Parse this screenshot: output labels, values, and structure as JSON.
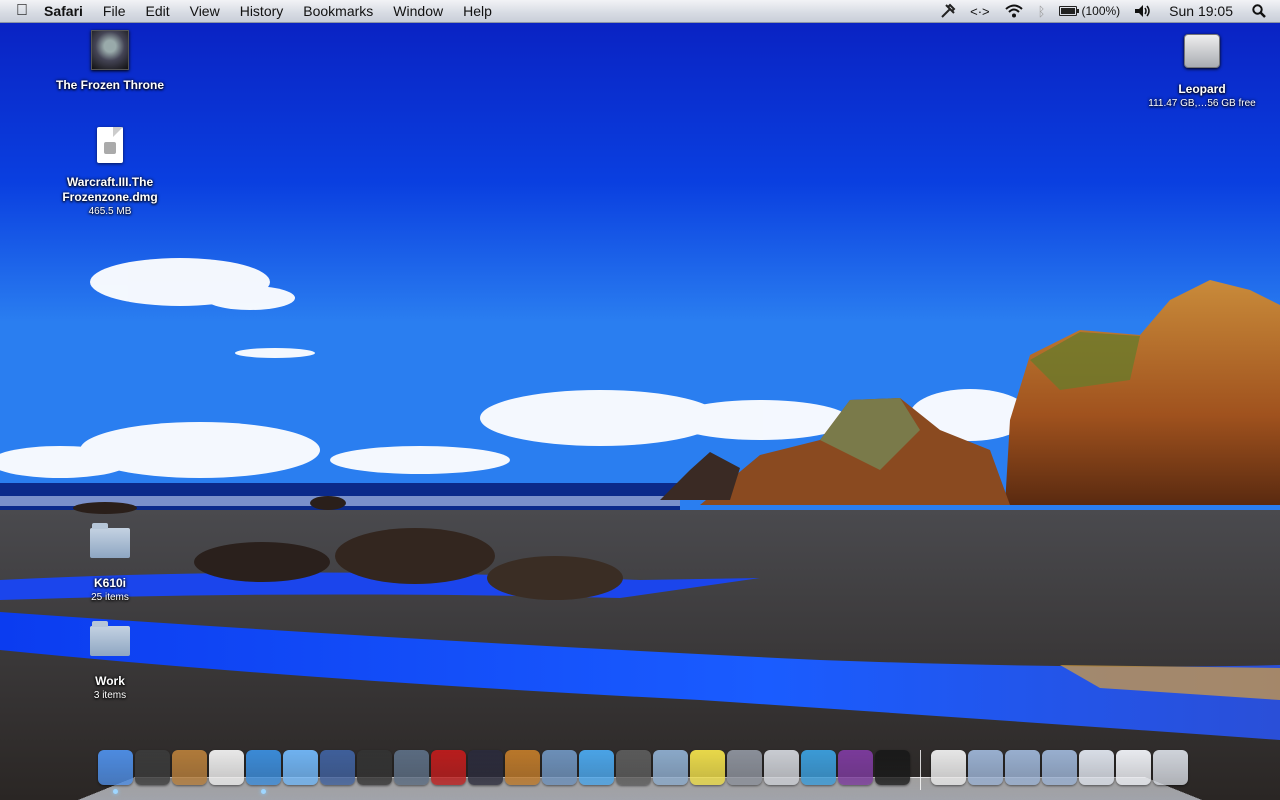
{
  "menubar": {
    "apple_icon": "apple-icon",
    "app_name": "Safari",
    "menus": [
      "File",
      "Edit",
      "View",
      "History",
      "Bookmarks",
      "Window",
      "Help"
    ],
    "battery_text": "(100%)",
    "battery_level": 1.0,
    "clock": "Sun 19:05"
  },
  "desktop": {
    "frozen_throne": {
      "name": "The Frozen Throne"
    },
    "dmg": {
      "name_line1": "Warcraft.III.The",
      "name_line2": "Frozenzone.dmg",
      "info": "465.5 MB"
    },
    "leopard": {
      "name": "Leopard",
      "info": "111.47 GB,…56 GB free"
    },
    "k610i": {
      "name": "K610i",
      "info": "25 items"
    },
    "work": {
      "name": "Work",
      "info": "3 items"
    }
  },
  "dock": {
    "apps": [
      {
        "icon": "finder-icon",
        "color": "#4d8be0",
        "running": true
      },
      {
        "icon": "dashboard-icon",
        "color": "#3a3a3a",
        "running": false
      },
      {
        "icon": "address-book-icon",
        "color": "#b07a3a",
        "running": false
      },
      {
        "icon": "ical-icon",
        "color": "#e8e8e8",
        "running": false
      },
      {
        "icon": "safari-icon",
        "color": "#3b8ad6",
        "running": true
      },
      {
        "icon": "ichat-icon",
        "color": "#6fb2f0",
        "running": false
      },
      {
        "icon": "mail-icon",
        "color": "#3f5f9a",
        "running": false
      },
      {
        "icon": "photo-booth-icon",
        "color": "#333333",
        "running": false
      },
      {
        "icon": "spaces-icon",
        "color": "#5a6b80",
        "running": false
      },
      {
        "icon": "photo-album-icon",
        "color": "#b81d1d",
        "running": false
      },
      {
        "icon": "x11-icon",
        "color": "#2b2b3b",
        "running": false
      },
      {
        "icon": "garageband-icon",
        "color": "#b9772a",
        "running": false
      },
      {
        "icon": "iphoto-icon",
        "color": "#6c8fb8",
        "running": false
      },
      {
        "icon": "itunes-icon",
        "color": "#4aa3e6",
        "running": false
      },
      {
        "icon": "imovie-icon",
        "color": "#5a5a5a",
        "running": false
      },
      {
        "icon": "preview-icon",
        "color": "#8aa8c8",
        "running": false
      },
      {
        "icon": "stickies-icon",
        "color": "#e8d84a",
        "running": false
      },
      {
        "icon": "system-preferences-icon",
        "color": "#8a8f99",
        "running": false
      },
      {
        "icon": "text-edit-icon",
        "color": "#c9ccd2",
        "running": false
      },
      {
        "icon": "messenger-icon",
        "color": "#3b9ad6",
        "running": false
      },
      {
        "icon": "adium-icon",
        "color": "#7a3a9a",
        "running": false
      },
      {
        "icon": "activity-monitor-icon",
        "color": "#1a1a1a",
        "running": false
      }
    ],
    "stacks": [
      {
        "icon": "home-folder-icon",
        "color": "#e6e6e6"
      },
      {
        "icon": "applications-folder-icon",
        "color": "#98afcf"
      },
      {
        "icon": "downloads-folder-icon",
        "color": "#98afcf"
      },
      {
        "icon": "documents-folder-icon",
        "color": "#98afcf"
      },
      {
        "icon": "network-icon",
        "color": "#d8dde6"
      },
      {
        "icon": "drive-stack-icon",
        "color": "#e8eaef"
      },
      {
        "icon": "trash-icon",
        "color": "#cfd3da"
      }
    ]
  }
}
